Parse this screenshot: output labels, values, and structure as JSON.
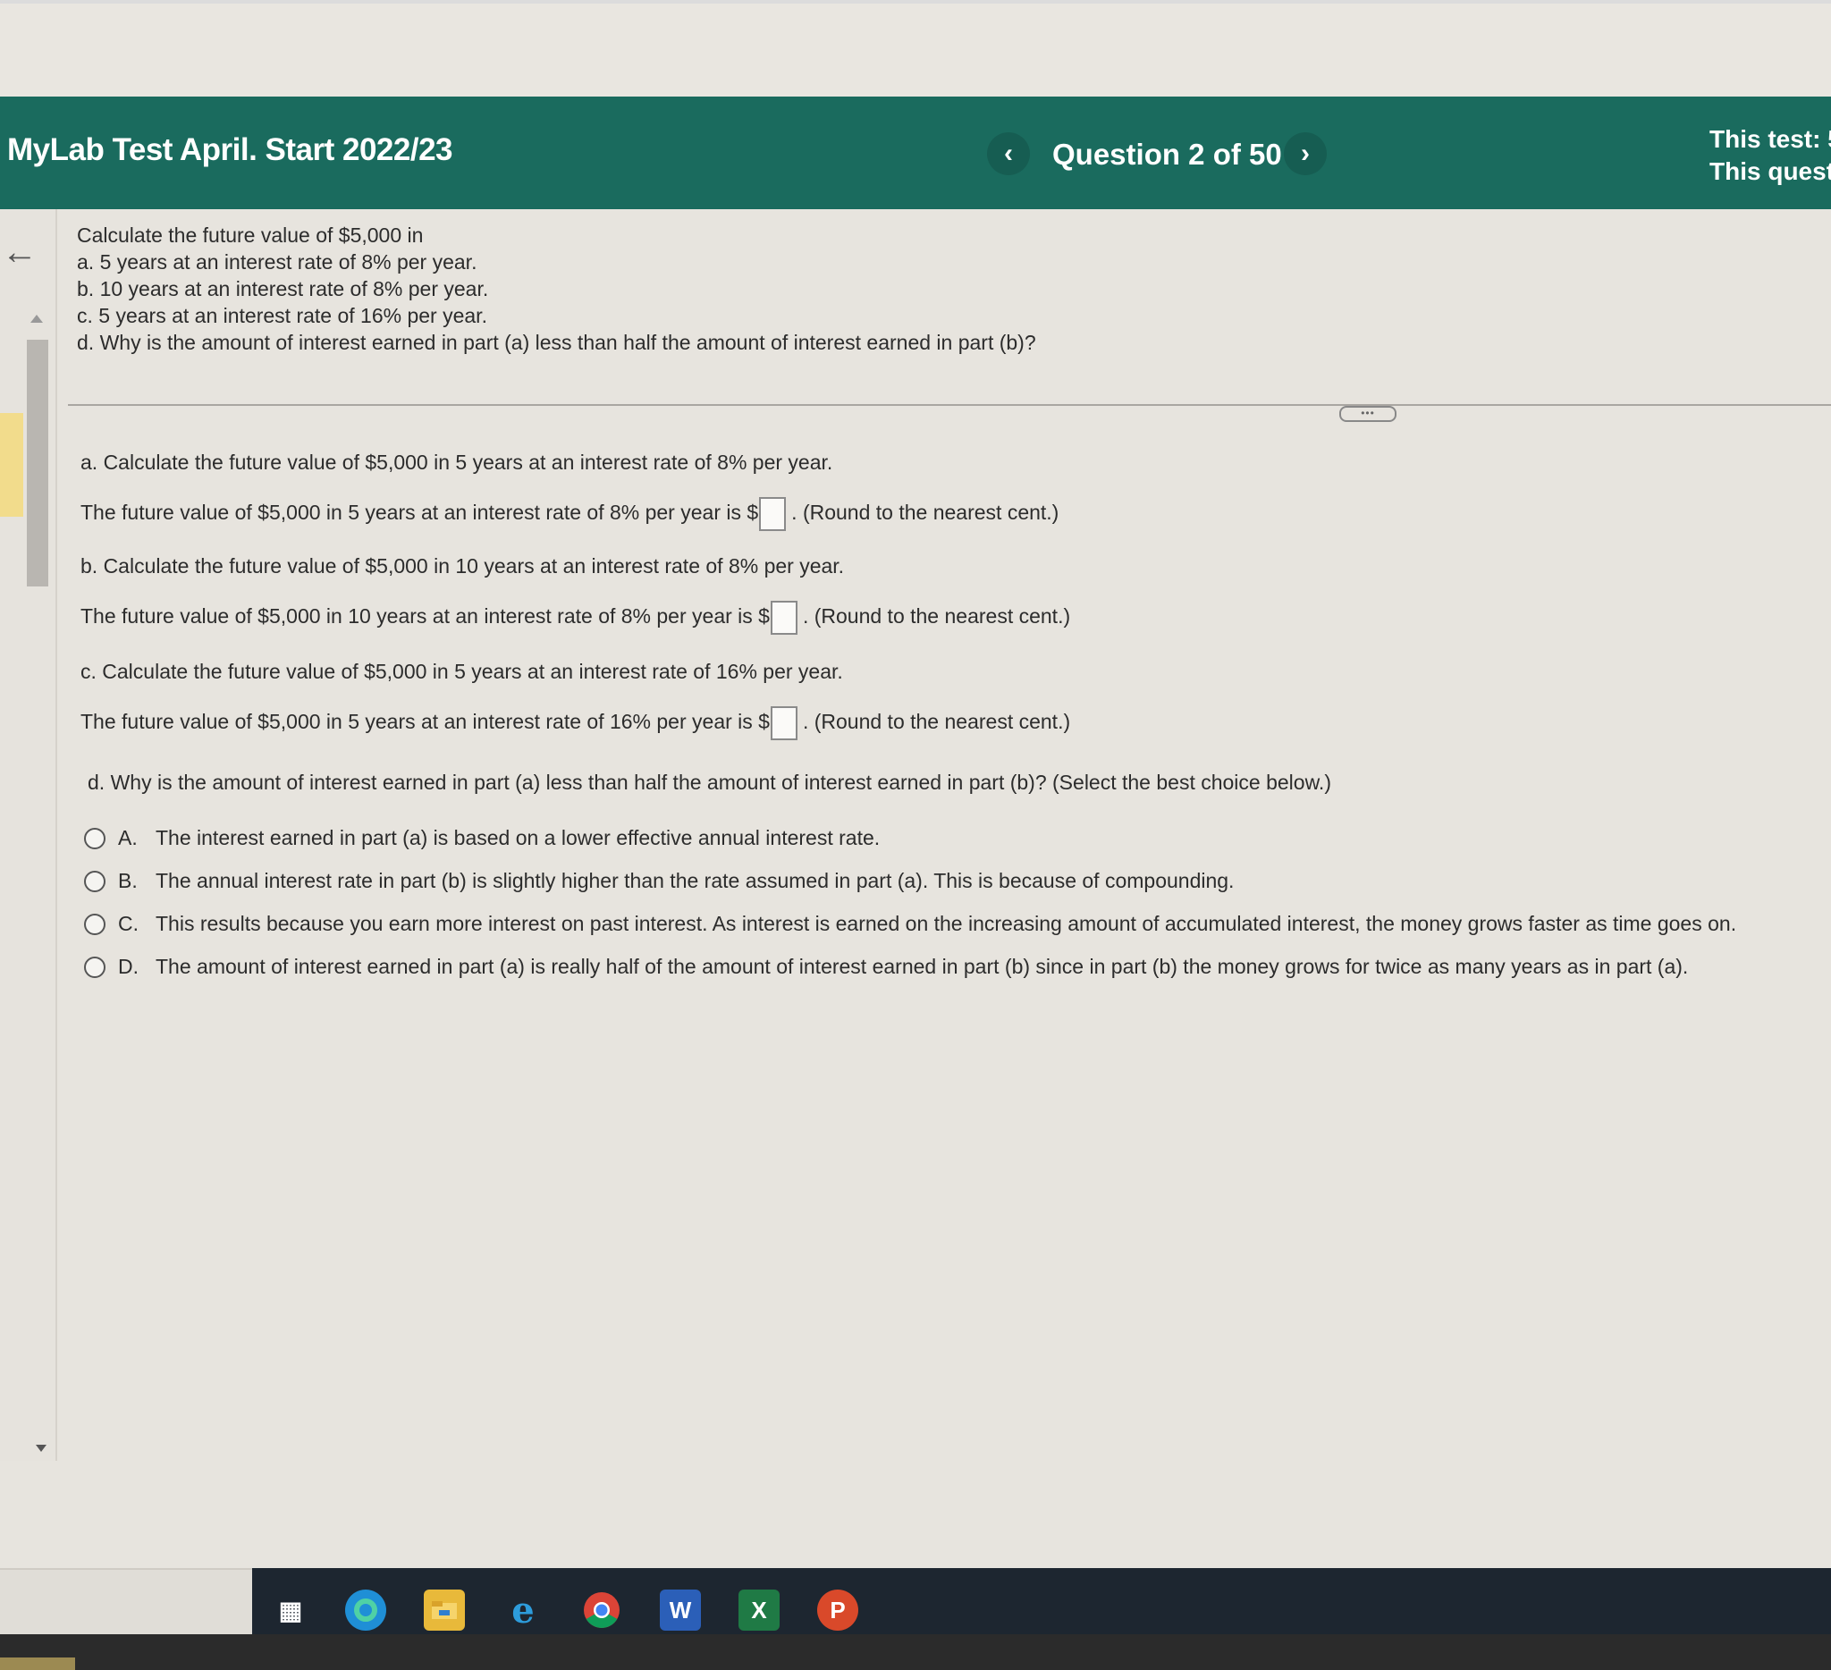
{
  "header": {
    "app_title": "MyLab Test April. Start 2022/23",
    "question_counter": "Question 2 of 50",
    "prev_icon": "‹",
    "next_icon": "›",
    "test_info_line1": "This test: 5",
    "test_info_line2": "This quest"
  },
  "question": {
    "intro": "Calculate the future value of $5,000 in",
    "items": [
      "a. 5 years at an interest rate of 8% per year.",
      "b. 10 years at an interest rate of 8% per year.",
      "c. 5 years at an interest rate of 16% per year.",
      "d. Why is the amount of interest earned in part (a) less than half the amount of interest earned in part (b)?"
    ]
  },
  "parts": {
    "a_prompt": "a. Calculate the future value of $5,000 in 5 years at an interest rate of 8% per year.",
    "a_answer_prefix": "The future value of $5,000 in 5 years at an interest rate of 8% per year is $",
    "a_answer_suffix": ". (Round to the nearest cent.)",
    "b_prompt": "b. Calculate the future value of $5,000 in 10 years at an interest rate of 8% per year.",
    "b_answer_prefix": "The future value of $5,000 in 10 years at an interest rate of 8% per year is $",
    "b_answer_suffix": ". (Round to the nearest cent.)",
    "c_prompt": "c. Calculate the future value of $5,000 in 5 years at an interest rate of 16% per year.",
    "c_answer_prefix": "The future value of $5,000 in 5 years at an interest rate of 16% per year is $",
    "c_answer_suffix": ". (Round to the nearest cent.)",
    "d_prompt": "d. Why is the amount of interest earned in part (a) less than half the amount of interest earned in part (b)? (Select the best choice below.)"
  },
  "choices": [
    {
      "letter": "A.",
      "text": "The interest earned in part (a) is based on a lower effective annual interest rate."
    },
    {
      "letter": "B.",
      "text": "The annual interest rate in part (b) is slightly higher than the rate assumed in part (a). This is because of compounding."
    },
    {
      "letter": "C.",
      "text": "This results because you earn more interest on past interest. As interest is earned on the increasing amount of accumulated interest, the money grows faster as time goes on."
    },
    {
      "letter": "D.",
      "text": "The amount of interest earned in part (a) is really half of the amount of interest earned in part (b) since in part (b) the money grows for twice as many years as in part (a)."
    }
  ],
  "taskbar": {
    "icons": [
      "task-view-icon",
      "edge-icon",
      "file-explorer-icon",
      "internet-explorer-icon",
      "chrome-icon",
      "word-icon",
      "excel-icon",
      "powerpoint-icon"
    ],
    "word_letter": "W",
    "excel_letter": "X",
    "powerpoint_letter": "P",
    "ie_letter": "e"
  },
  "colors": {
    "header_bg": "#1a6b5e",
    "taskbar_bg": "#1d2630"
  }
}
